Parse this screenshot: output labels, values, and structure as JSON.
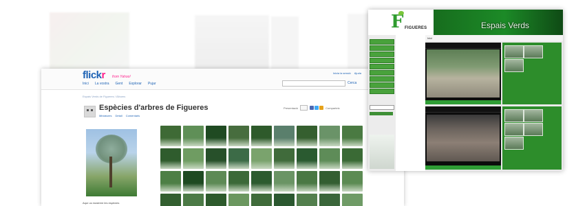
{
  "flickr": {
    "logo_main": "flickr",
    "logo_tagline": "from Yahoo!",
    "nav": [
      "Inici",
      "La vostra",
      "Gent",
      "Explorar",
      "Pujar"
    ],
    "top_links": [
      "Inicia la sessió",
      "Ajuda"
    ],
    "search_label": "Cerca",
    "breadcrumb": "Espais Verds de Figueres / Àlbums",
    "album_title": "Espècies d'arbres de Figueres",
    "subtabs": [
      "Miniatures",
      "Detall",
      "Comentaris"
    ],
    "sort_label": "Presentació",
    "share_label": "Comparteix",
    "photo_caption": "Aquí us mostrem les espècies",
    "thumb_colors": [
      "#3e6a35",
      "#5f8f57",
      "#1f4a22",
      "#476d3e",
      "#2e5a2b",
      "#5a7f6c",
      "#355f2f",
      "#6a9368",
      "#4a7a42",
      "#2f5c2d",
      "#6f9c62",
      "#27502a",
      "#3c6b47",
      "#7aa36d",
      "#406b3b",
      "#2a5a30",
      "#5e8c58",
      "#3a6a35",
      "#4d7f45",
      "#1e4a21",
      "#5d8a55",
      "#3b6938",
      "#2c5b2f",
      "#6a9464",
      "#4a7844",
      "#335e31",
      "#5c8b53",
      "#335f30",
      "#4c7a46",
      "#2d5a2c",
      "#6b975f",
      "#3f6b3a",
      "#2b5830",
      "#537f4d",
      "#3a663a",
      "#6f9b66"
    ]
  },
  "espais": {
    "logo_letter": "F",
    "logo_text": "FIGUERES",
    "header_title": "Espais Verds",
    "tab_label": "Inici"
  }
}
